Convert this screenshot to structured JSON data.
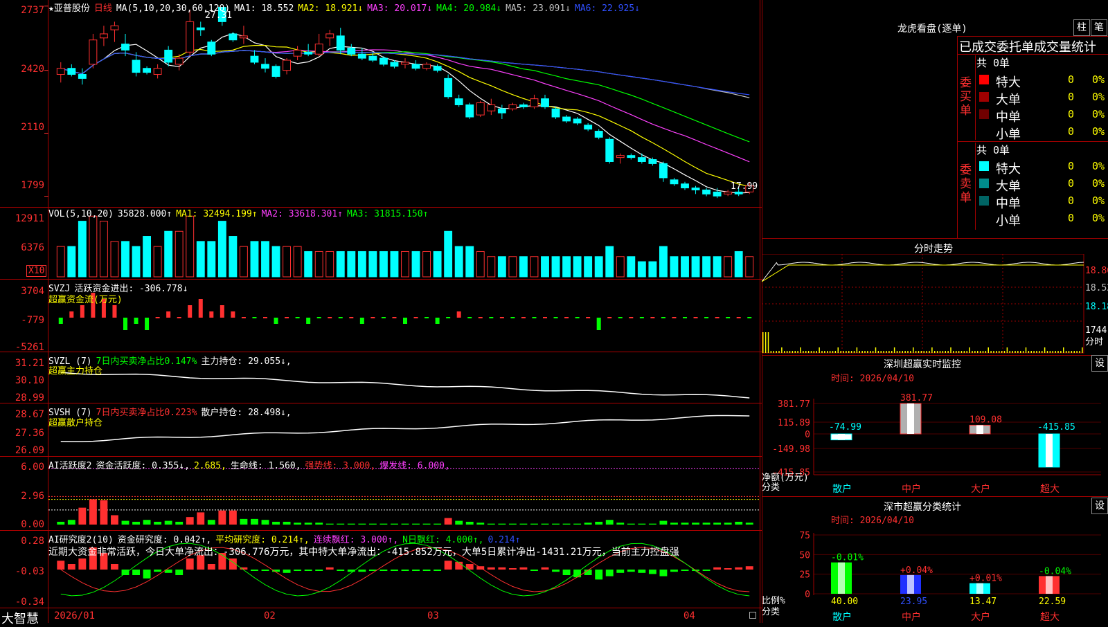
{
  "stock": {
    "name": "★亚普股份",
    "period": "日线",
    "ma_label": "MA(5,10,20,30,60,120)",
    "ma": [
      {
        "label": "MA1:",
        "value": "18.552",
        "arrow": "",
        "color": "#ffffff"
      },
      {
        "label": "MA2:",
        "value": "18.921",
        "arrow": "↓",
        "color": "#ffff00"
      },
      {
        "label": "MA3:",
        "value": "20.017",
        "arrow": "↓",
        "color": "#ff40ff"
      },
      {
        "label": "MA4:",
        "value": "20.984",
        "arrow": "↓",
        "color": "#00ff00"
      },
      {
        "label": "MA5:",
        "value": "23.091",
        "arrow": "↓",
        "color": "#c0c0c0"
      },
      {
        "label": "MA6:",
        "value": "22.925",
        "arrow": "↓",
        "color": "#3050ff"
      }
    ],
    "high_mark": "27.31",
    "low_mark": "17.99"
  },
  "price_axis": [
    "2737",
    "2420",
    "2110",
    "1799"
  ],
  "vol": {
    "title": "VOL(5,10,20)",
    "value": "35828.000↑",
    "ma1": "MA1: 32494.199↑",
    "ma2": "MA2: 33618.301↑",
    "ma3": "MA3: 31815.150↑",
    "axis": [
      "12911",
      "6376"
    ],
    "unit": "X10"
  },
  "svzj": {
    "title": "SVZJ",
    "label": "活跃资金进出: -306.778↓",
    "sub": "超赢资金流(万元)",
    "axis": [
      "3704",
      "-779",
      "-5261"
    ]
  },
  "svzl": {
    "title": "SVZL (7)",
    "label1": "7日内买卖净占比0.147%",
    "label2": "主力持仓: 29.055↓,",
    "sub": "超赢主力持仓",
    "axis": [
      "31.21",
      "30.10",
      "28.99"
    ]
  },
  "svsh": {
    "title": "SVSH (7)",
    "label1": "7日内买卖净占比0.223%",
    "label2": "散户持仓: 28.498↓,",
    "sub": "超赢散户持仓",
    "axis": [
      "28.67",
      "27.36",
      "26.09"
    ]
  },
  "ai_active": {
    "title": "AI活跃度2",
    "l1": "资金活跃度: 0.355↓,",
    "l2": "2.685,",
    "l3": "生命线: 1.560,",
    "l4": "强势线: 3.000,",
    "l5": "爆发线: 6.000,",
    "axis": [
      "6.00",
      "2.96",
      "0.00"
    ]
  },
  "ai_research": {
    "title": "AI研究度2(10)",
    "l1": "资金研究度: 0.042↑,",
    "l2": "平均研究度: 0.214↑,",
    "l3": "连续飘红: 3.000↑,",
    "l4": "N日飘红: 4.000↑,",
    "l5": "0.214↑",
    "desc": "近期大资金非常活跃，今日大单净流出：-306.776万元，其中特大单净流出：-415.852万元，大单5日累计净出-1431.21万元，当前主力控盘强",
    "axis": [
      "0.28",
      "-0.03",
      "-0.34"
    ]
  },
  "xaxis": {
    "brand": "大智慧",
    "labels": [
      "2026/01",
      "02",
      "03",
      "04"
    ]
  },
  "dragon": {
    "title": "龙虎看盘(逐单)",
    "btn1": "柱",
    "btn2": "笔",
    "subtitle": "已成交委托单成交量统计",
    "buy_label": "委买单",
    "sell_label": "委卖单",
    "buy_total": "共 0单",
    "sell_total": "共 0单",
    "rows": [
      {
        "name": "特大",
        "count": "0",
        "pct": "0%"
      },
      {
        "name": "大单",
        "count": "0",
        "pct": "0%"
      },
      {
        "name": "中单",
        "count": "0",
        "pct": "0%"
      },
      {
        "name": "小单",
        "count": "0",
        "pct": "0%"
      }
    ],
    "buy_colors": [
      "#ff0000",
      "#a00000",
      "#700000",
      "#000000"
    ],
    "sell_colors": [
      "#00ffff",
      "#008c8c",
      "#006464",
      "#000000"
    ]
  },
  "intraday": {
    "title": "分时走势",
    "axis": [
      "18.86",
      "18.52",
      "18.18",
      "1744"
    ],
    "unit": "分时"
  },
  "sz_monitor": {
    "title": "深圳超赢实时监控",
    "btn": "设",
    "date": "时间: 2026/04/10",
    "axis": [
      "381.77",
      "115.89",
      "0",
      "-149.98",
      "-415.85"
    ],
    "axis_label1": "净额(万元)",
    "axis_label2": "分类",
    "values": [
      "-74.99",
      "381.77",
      "109.08",
      "-415.85"
    ],
    "cats": [
      "散户",
      "中户",
      "大户",
      "超大"
    ]
  },
  "sz_class": {
    "title": "深市超赢分类统计",
    "btn": "设",
    "date": "时间: 2026/04/10",
    "axis": [
      "75",
      "50",
      "25",
      "0"
    ],
    "axis_label1": "比例%",
    "axis_label2": "分类",
    "deltas": [
      "-0.01%",
      "+0.04%",
      "+0.01%",
      "-0.04%"
    ],
    "values": [
      "40.00",
      "23.95",
      "13.47",
      "22.59"
    ],
    "cats": [
      "散户",
      "中户",
      "大户",
      "超大"
    ]
  },
  "chart_data": {
    "type": "candlestick",
    "price_axis_range": [
      17.99,
      27.31
    ],
    "ohlc": [
      [
        24.0,
        24.6,
        23.6,
        24.3
      ],
      [
        24.3,
        24.5,
        23.9,
        24.0
      ],
      [
        24.0,
        24.3,
        23.5,
        23.8
      ],
      [
        24.5,
        26.0,
        24.3,
        25.7
      ],
      [
        25.8,
        26.4,
        25.4,
        26.0
      ],
      [
        26.2,
        26.6,
        25.6,
        26.4
      ],
      [
        25.5,
        26.0,
        24.9,
        25.2
      ],
      [
        24.7,
        25.1,
        23.9,
        24.1
      ],
      [
        24.3,
        24.4,
        24.0,
        24.1
      ],
      [
        24.0,
        24.5,
        23.8,
        24.3
      ],
      [
        25.2,
        25.4,
        24.4,
        24.6
      ],
      [
        24.5,
        25.0,
        24.2,
        24.8
      ],
      [
        25.1,
        27.2,
        24.9,
        26.6
      ],
      [
        26.3,
        26.6,
        25.9,
        26.2
      ],
      [
        25.6,
        25.7,
        24.9,
        25.0
      ],
      [
        27.31,
        27.31,
        26.4,
        26.6
      ],
      [
        26.0,
        26.1,
        25.6,
        25.7
      ],
      [
        25.8,
        26.4,
        25.5,
        25.9
      ],
      [
        24.9,
        25.2,
        24.5,
        24.6
      ],
      [
        24.5,
        24.8,
        24.1,
        24.3
      ],
      [
        24.4,
        24.5,
        23.8,
        23.9
      ],
      [
        24.2,
        24.8,
        24.0,
        24.7
      ],
      [
        24.9,
        25.4,
        24.7,
        25.2
      ],
      [
        25.1,
        25.5,
        24.9,
        25.0
      ],
      [
        25.0,
        26.0,
        24.9,
        25.5
      ],
      [
        25.8,
        26.2,
        25.4,
        26.0
      ],
      [
        25.9,
        26.3,
        25.0,
        25.2
      ],
      [
        25.3,
        25.5,
        24.9,
        25.0
      ],
      [
        25.0,
        25.3,
        24.7,
        24.8
      ],
      [
        24.9,
        25.1,
        24.6,
        24.7
      ],
      [
        24.8,
        24.9,
        24.4,
        24.5
      ],
      [
        24.6,
        24.7,
        24.3,
        24.4
      ],
      [
        24.5,
        24.8,
        24.3,
        24.6
      ],
      [
        24.5,
        24.7,
        24.2,
        24.3
      ],
      [
        24.3,
        24.6,
        24.2,
        24.5
      ],
      [
        24.4,
        24.5,
        24.1,
        24.2
      ],
      [
        23.8,
        24.0,
        22.8,
        22.9
      ],
      [
        22.8,
        23.0,
        22.4,
        22.5
      ],
      [
        22.5,
        22.6,
        21.8,
        21.9
      ],
      [
        22.0,
        22.7,
        21.9,
        22.6
      ],
      [
        22.2,
        22.8,
        22.0,
        22.5
      ],
      [
        22.3,
        22.5,
        21.8,
        22.1
      ],
      [
        22.3,
        22.6,
        22.2,
        22.5
      ],
      [
        22.5,
        22.6,
        22.3,
        22.4
      ],
      [
        22.4,
        23.0,
        22.3,
        22.8
      ],
      [
        22.8,
        23.0,
        22.3,
        22.4
      ],
      [
        22.3,
        22.4,
        21.8,
        21.9
      ],
      [
        21.9,
        22.0,
        21.6,
        21.7
      ],
      [
        21.8,
        21.9,
        21.5,
        21.6
      ],
      [
        21.5,
        21.6,
        21.2,
        21.3
      ],
      [
        21.2,
        21.3,
        20.8,
        20.9
      ],
      [
        20.8,
        20.9,
        19.6,
        19.7
      ],
      [
        19.9,
        20.1,
        19.6,
        20.0
      ],
      [
        20.0,
        20.1,
        19.8,
        19.9
      ],
      [
        19.9,
        20.1,
        19.6,
        19.7
      ],
      [
        19.8,
        19.9,
        19.5,
        19.6
      ],
      [
        19.6,
        19.7,
        18.7,
        18.9
      ],
      [
        18.8,
        18.9,
        18.5,
        18.6
      ],
      [
        18.6,
        18.7,
        18.3,
        18.4
      ],
      [
        18.4,
        18.5,
        18.1,
        18.3
      ],
      [
        18.3,
        18.4,
        17.99,
        18.1
      ],
      [
        18.2,
        18.4,
        17.9,
        18.0
      ],
      [
        18.1,
        18.3,
        18.0,
        18.2
      ],
      [
        18.2,
        18.4,
        18.0,
        18.1
      ],
      [
        18.2,
        18.7,
        18.1,
        18.5
      ]
    ],
    "volume": [
      6,
      6,
      11,
      12,
      11,
      7,
      7,
      6,
      8,
      6,
      9,
      9,
      12,
      7,
      7,
      11,
      8,
      6,
      7,
      7,
      6,
      6,
      6,
      5,
      5,
      5,
      5,
      5,
      5,
      5,
      5,
      5,
      5,
      5,
      5,
      5,
      9,
      6,
      6,
      5,
      4,
      4,
      4,
      4,
      4,
      4,
      4,
      4,
      4,
      4,
      4,
      6,
      4,
      4,
      3,
      3,
      6,
      4,
      4,
      4,
      4,
      4,
      4,
      5,
      4
    ],
    "svzj": [
      -1,
      1,
      2,
      4,
      3,
      2,
      -2,
      -1,
      -2,
      0,
      1,
      0,
      2,
      3,
      1,
      2,
      1,
      0,
      0,
      0,
      -1,
      0,
      0,
      -1,
      0,
      0,
      0,
      0,
      -1,
      0,
      0,
      0,
      -1,
      0,
      0,
      -1,
      0,
      1,
      0,
      0,
      0,
      0,
      0,
      0,
      0,
      0,
      0,
      0,
      0,
      0,
      -2,
      0,
      0,
      0,
      0,
      0,
      0,
      0,
      0,
      0,
      0,
      0,
      0,
      0,
      0
    ],
    "ai_active": [
      0.3,
      0.5,
      1.8,
      2.7,
      2.6,
      1.0,
      0.4,
      0.3,
      0.5,
      0.3,
      0.4,
      0.3,
      0.8,
      1.3,
      0.5,
      1.5,
      1.5,
      0.6,
      0.6,
      0.5,
      0.3,
      0.3,
      0.2,
      0.2,
      0.2,
      0.1,
      0.1,
      0.1,
      0.1,
      0.1,
      0.1,
      0.1,
      0.1,
      0.1,
      0.1,
      0.1,
      0.7,
      0.4,
      0.3,
      0.2,
      0.1,
      0.1,
      0.1,
      0.1,
      0.1,
      0.1,
      0.1,
      0.1,
      0.1,
      0.2,
      0.3,
      0.5,
      0.2,
      0.1,
      0.1,
      0.1,
      0.4,
      0.2,
      0.2,
      0.2,
      0.2,
      0.2,
      0.2,
      0.3,
      0.2
    ],
    "ai_research": [
      0.08,
      0.05,
      0.1,
      0.2,
      0.15,
      0.05,
      -0.05,
      -0.05,
      -0.08,
      -0.02,
      -0.03,
      -0.05,
      0.1,
      0.13,
      0.05,
      0.15,
      0.1,
      0.02,
      0.0,
      0.0,
      -0.02,
      -0.03,
      -0.01,
      -0.01,
      0.0,
      0.02,
      0.0,
      -0.02,
      -0.02,
      -0.01,
      0.0,
      -0.01,
      0.0,
      -0.01,
      0.0,
      -0.01,
      0.08,
      0.07,
      0.05,
      0.03,
      0.02,
      0.02,
      0.01,
      0.02,
      0.0,
      0.02,
      -0.02,
      -0.05,
      -0.07,
      -0.05,
      -0.09,
      -0.06,
      -0.03,
      -0.02,
      -0.03,
      -0.04,
      -0.06,
      -0.02,
      -0.01,
      0.0,
      0.0,
      0.02,
      0.01,
      0.02,
      0.03
    ]
  }
}
